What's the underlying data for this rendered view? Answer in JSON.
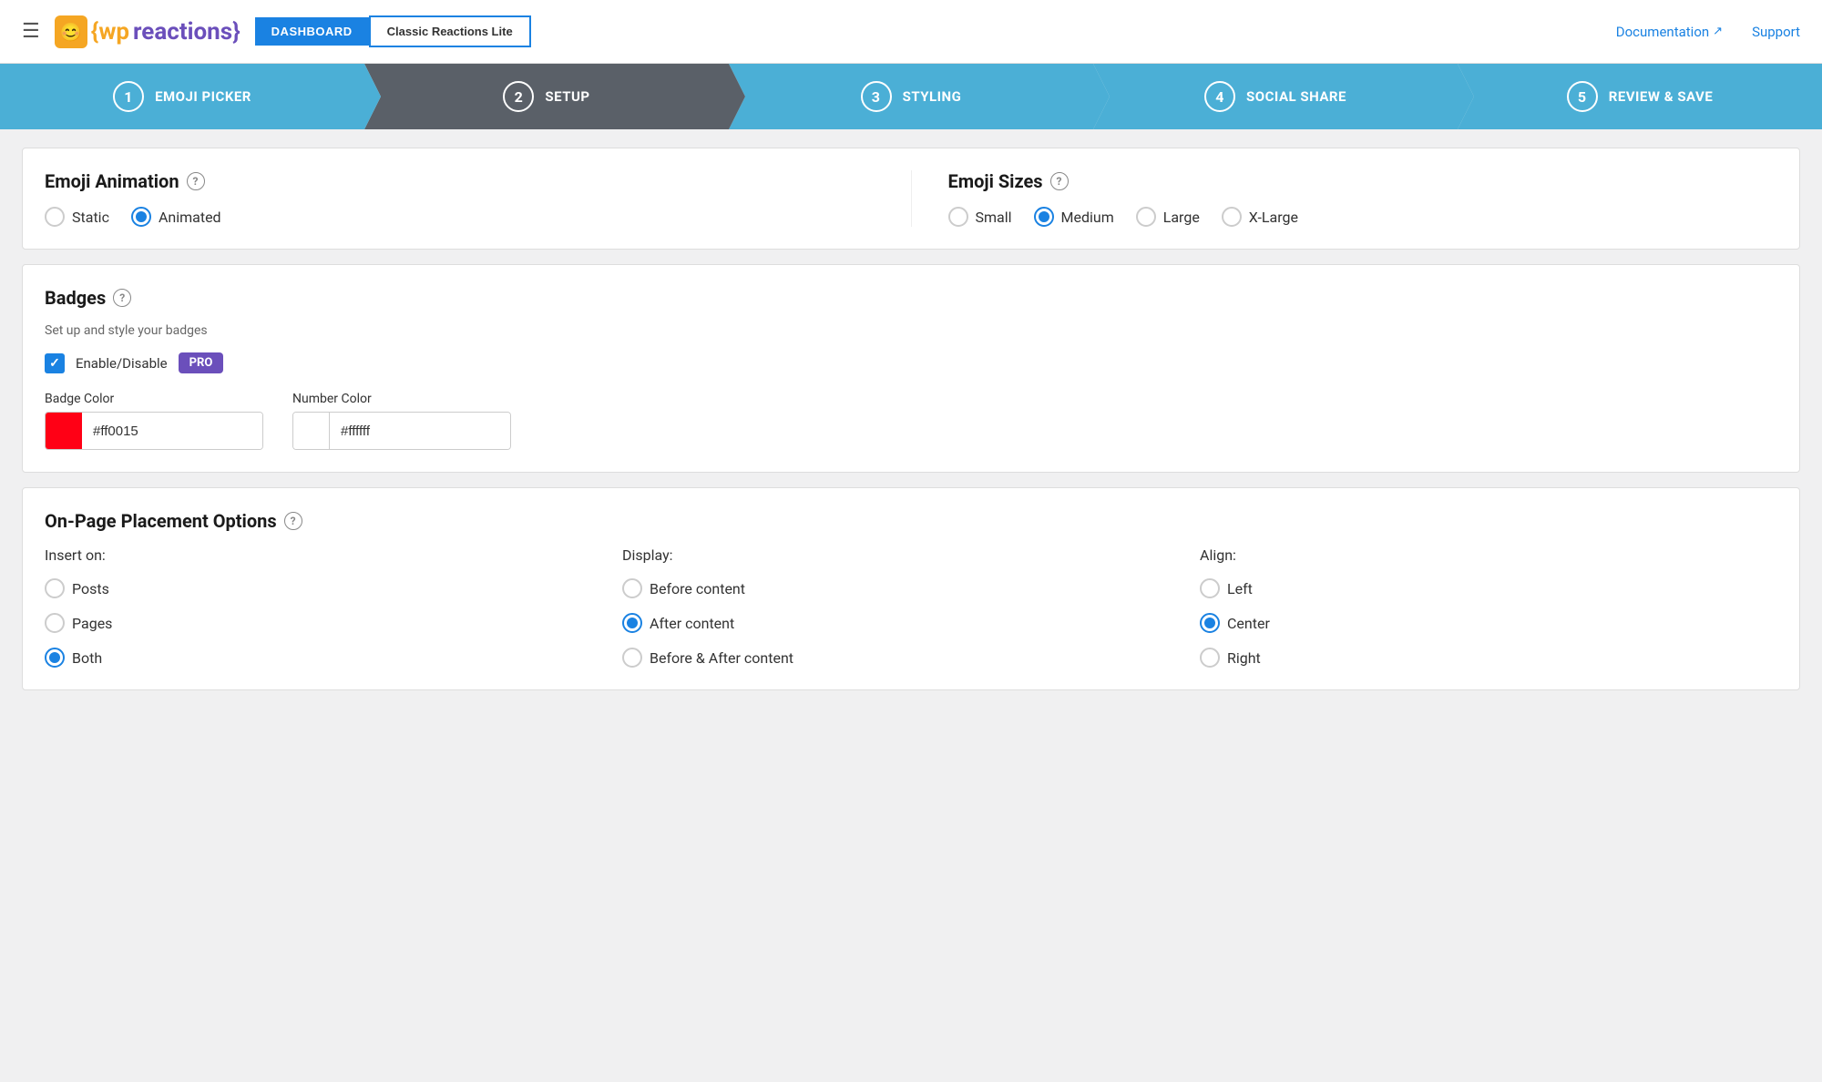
{
  "header": {
    "menu_icon": "☰",
    "logo_icon": "😊",
    "logo_wp": "{wp",
    "logo_reactions": "reactions}",
    "nav_dashboard": "DASHBOARD",
    "nav_classic": "Classic Reactions Lite",
    "doc_link": "Documentation",
    "doc_icon": "↗",
    "support_link": "Support"
  },
  "wizard": {
    "steps": [
      {
        "num": "1",
        "label": "EMOJI PICKER",
        "active": false
      },
      {
        "num": "2",
        "label": "SETUP",
        "active": true
      },
      {
        "num": "3",
        "label": "STYLING",
        "active": false
      },
      {
        "num": "4",
        "label": "SOCIAL SHARE",
        "active": false
      },
      {
        "num": "5",
        "label": "REVIEW & SAVE",
        "active": false
      }
    ]
  },
  "emoji_animation": {
    "title": "Emoji Animation",
    "options": [
      {
        "id": "static",
        "label": "Static",
        "checked": false
      },
      {
        "id": "animated",
        "label": "Animated",
        "checked": true
      }
    ]
  },
  "emoji_sizes": {
    "title": "Emoji Sizes",
    "options": [
      {
        "id": "small",
        "label": "Small",
        "checked": false
      },
      {
        "id": "medium",
        "label": "Medium",
        "checked": true
      },
      {
        "id": "large",
        "label": "Large",
        "checked": false
      },
      {
        "id": "xlarge",
        "label": "X-Large",
        "checked": false
      }
    ]
  },
  "badges": {
    "title": "Badges",
    "subtitle": "Set up and style your badges",
    "enable_label": "Enable/Disable",
    "pro_label": "PRO",
    "badge_color_label": "Badge Color",
    "badge_color_value": "#ff0015",
    "number_color_label": "Number Color",
    "number_color_value": "#ffffff"
  },
  "placement": {
    "title": "On-Page Placement Options",
    "insert_title": "Insert on:",
    "insert_options": [
      {
        "id": "posts",
        "label": "Posts",
        "checked": false
      },
      {
        "id": "pages",
        "label": "Pages",
        "checked": false
      },
      {
        "id": "both",
        "label": "Both",
        "checked": true
      }
    ],
    "display_title": "Display:",
    "display_options": [
      {
        "id": "before",
        "label": "Before content",
        "checked": false
      },
      {
        "id": "after",
        "label": "After content",
        "checked": true
      },
      {
        "id": "both_content",
        "label": "Before & After content",
        "checked": false
      }
    ],
    "align_title": "Align:",
    "align_options": [
      {
        "id": "left",
        "label": "Left",
        "checked": false
      },
      {
        "id": "center",
        "label": "Center",
        "checked": true
      },
      {
        "id": "right",
        "label": "Right",
        "checked": false
      }
    ]
  }
}
